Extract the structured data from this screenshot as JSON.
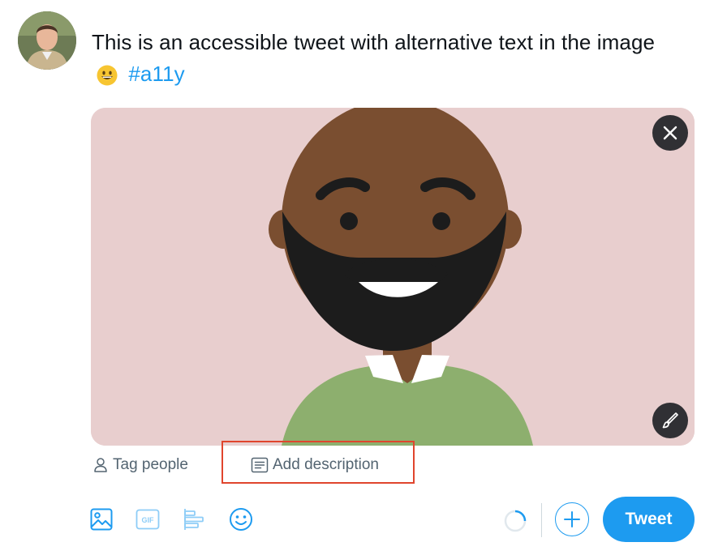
{
  "composer": {
    "avatar_alt": "User avatar",
    "text": "This is an accessible tweet with alternative text in the image",
    "emoji": "😀",
    "hashtag": "#a11y"
  },
  "media": {
    "close_icon": "close-icon",
    "edit_icon": "brush-icon"
  },
  "media_actions": {
    "tag_people": "Tag people",
    "add_description": "Add description"
  },
  "toolbar": {
    "icons": [
      "image-icon",
      "gif-icon",
      "poll-icon",
      "emoji-icon"
    ],
    "tweet_button": "Tweet"
  },
  "colors": {
    "accent": "#1d9bf0",
    "highlight_box": "#e0452d",
    "image_background": "#e8cece"
  }
}
